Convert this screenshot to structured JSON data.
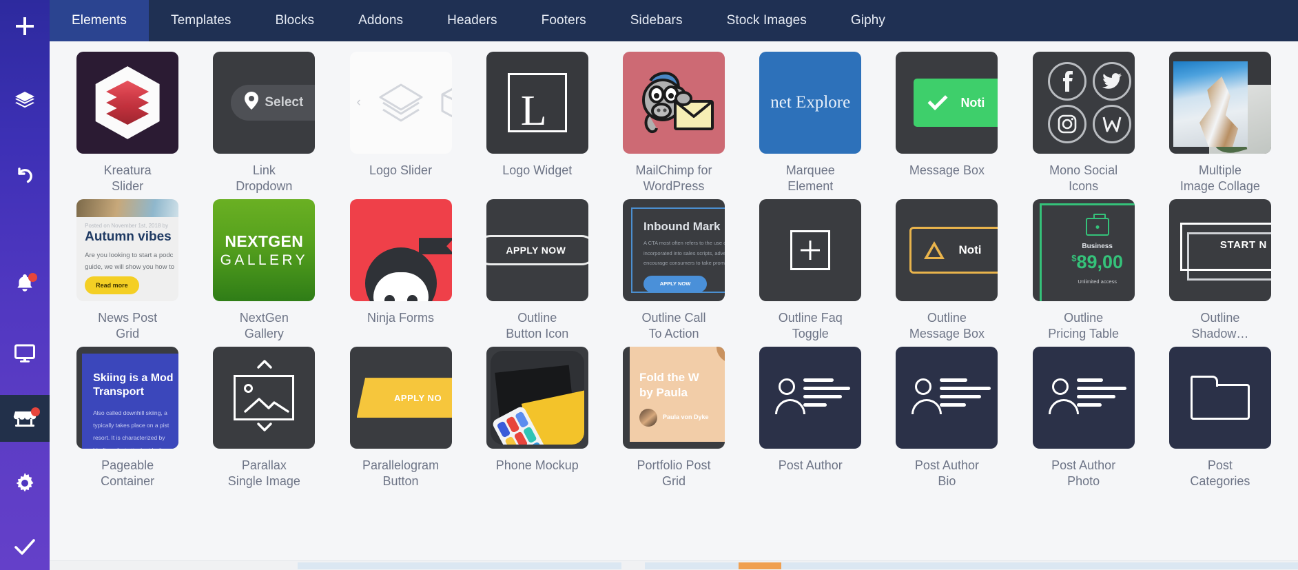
{
  "rail": {
    "items": [
      {
        "name": "add-element",
        "icon": "plus-icon",
        "badge": false,
        "active": false
      },
      {
        "name": "layers",
        "icon": "layers-icon",
        "badge": false,
        "active": false
      },
      {
        "name": "history-undo",
        "icon": "undo-icon",
        "badge": false,
        "active": false
      },
      {
        "name": "notifications",
        "icon": "bell-icon",
        "badge": true,
        "active": false
      },
      {
        "name": "preview",
        "icon": "monitor-icon",
        "badge": false,
        "active": false
      },
      {
        "name": "store",
        "icon": "store-icon",
        "badge": true,
        "active": true
      },
      {
        "name": "settings",
        "icon": "gear-icon",
        "badge": false,
        "active": false
      },
      {
        "name": "publish",
        "icon": "check-icon",
        "badge": false,
        "active": false
      }
    ]
  },
  "tabs": [
    {
      "label": "Elements",
      "active": true
    },
    {
      "label": "Templates",
      "active": false
    },
    {
      "label": "Blocks",
      "active": false
    },
    {
      "label": "Addons",
      "active": false
    },
    {
      "label": "Headers",
      "active": false
    },
    {
      "label": "Footers",
      "active": false
    },
    {
      "label": "Sidebars",
      "active": false
    },
    {
      "label": "Stock Images",
      "active": false
    },
    {
      "label": "Giphy",
      "active": false
    }
  ],
  "colors": {
    "rail_top": "#2d2a9e",
    "rail_bottom": "#6440c9",
    "tabbar": "#1f3053",
    "tab_active": "#2b4490",
    "pane_bg": "#f5f6f8",
    "caption": "#6d7486",
    "badge": "#e8453c",
    "scrollbar_thumb": "#f0a050",
    "scrollbar_track": "#dbe7f2"
  },
  "elements": [
    {
      "name": "Kreatura Slider",
      "caption": "Kreatura\nSlider",
      "thumb": "kreatura"
    },
    {
      "name": "Link Dropdown",
      "caption": "Link\nDropdown",
      "thumb": "link-dropdown",
      "text": "Select"
    },
    {
      "name": "Logo Slider",
      "caption": "Logo Slider",
      "thumb": "logo-slider"
    },
    {
      "name": "Logo Widget",
      "caption": "Logo Widget",
      "thumb": "logo-widget",
      "text": "L"
    },
    {
      "name": "MailChimp for WordPress",
      "caption": "MailChimp for\nWordPress",
      "thumb": "mailchimp"
    },
    {
      "name": "Marquee Element",
      "caption": "Marquee\nElement",
      "thumb": "marquee",
      "text": "net Explore"
    },
    {
      "name": "Message Box",
      "caption": "Message Box",
      "thumb": "message-box",
      "text": "Noti"
    },
    {
      "name": "Mono Social Icons",
      "caption": "Mono Social\nIcons",
      "thumb": "mono-social"
    },
    {
      "name": "Multiple Image Collage",
      "caption": "Multiple\nImage Collage",
      "thumb": "image-collage"
    },
    {
      "name": "News Post Grid",
      "caption": "News Post\nGrid",
      "thumb": "news-post-grid",
      "meta": "Posted on November 1st, 2018 by",
      "heading": "Autumn vibes",
      "body": "Are you looking to start a podc\nguide, we will show you how to",
      "button": "Read more"
    },
    {
      "name": "NextGen Gallery",
      "caption": "NextGen\nGallery",
      "thumb": "nextgen",
      "line1": "NEXTGEN",
      "line2": "GALLERY"
    },
    {
      "name": "Ninja Forms",
      "caption": "Ninja Forms",
      "thumb": "ninja-forms"
    },
    {
      "name": "Outline Button Icon",
      "caption": "Outline\nButton Icon",
      "thumb": "outline-button",
      "text": "APPLY NOW"
    },
    {
      "name": "Outline Call To Action",
      "caption": "Outline Call\nTo Action",
      "thumb": "outline-cta",
      "heading": "Inbound Mark",
      "body": "A CTA most often refers to the use of\nincorporated into sales scripts, adverti\nencourage consumers to take prompt",
      "button": "APPLY NOW"
    },
    {
      "name": "Outline Faq Toggle",
      "caption": "Outline Faq\nToggle",
      "thumb": "outline-faq"
    },
    {
      "name": "Outline Message Box",
      "caption": "Outline\nMessage Box",
      "thumb": "outline-message",
      "text": "Noti"
    },
    {
      "name": "Outline Pricing Table",
      "caption": "Outline\nPricing Table",
      "thumb": "outline-pricing",
      "plan": "Business",
      "currency": "$",
      "price": "89,00",
      "note": "Unlimited access"
    },
    {
      "name": "Outline Shadow",
      "caption": "Outline\nShadow…",
      "thumb": "outline-shadow",
      "text": "START N"
    },
    {
      "name": "Pageable Container",
      "caption": "Pageable\nContainer",
      "thumb": "pageable",
      "heading": "Skiing is a Mod\nTransport",
      "body": "Also called downhill skiing, a\ntypically takes place on a pist\nresort. It is characterized by\nbindings that attach at both"
    },
    {
      "name": "Parallax Single Image",
      "caption": "Parallax\nSingle Image",
      "thumb": "parallax-image"
    },
    {
      "name": "Parallelogram Button",
      "caption": "Parallelogram\nButton",
      "thumb": "parallelogram",
      "text": "APPLY NO"
    },
    {
      "name": "Phone Mockup",
      "caption": "Phone Mockup",
      "thumb": "phone-mockup"
    },
    {
      "name": "Portfolio Post Grid",
      "caption": "Portfolio Post\nGrid",
      "thumb": "portfolio",
      "heading": "Fold the W\nby Paula",
      "author": "Paula von Dyke"
    },
    {
      "name": "Post Author",
      "caption": "Post Author",
      "thumb": "post-author"
    },
    {
      "name": "Post Author Bio",
      "caption": "Post Author\nBio",
      "thumb": "post-author-bio"
    },
    {
      "name": "Post Author Photo",
      "caption": "Post Author\nPhoto",
      "thumb": "post-author-photo"
    },
    {
      "name": "Post Categories",
      "caption": "Post\nCategories",
      "thumb": "post-categories"
    }
  ]
}
